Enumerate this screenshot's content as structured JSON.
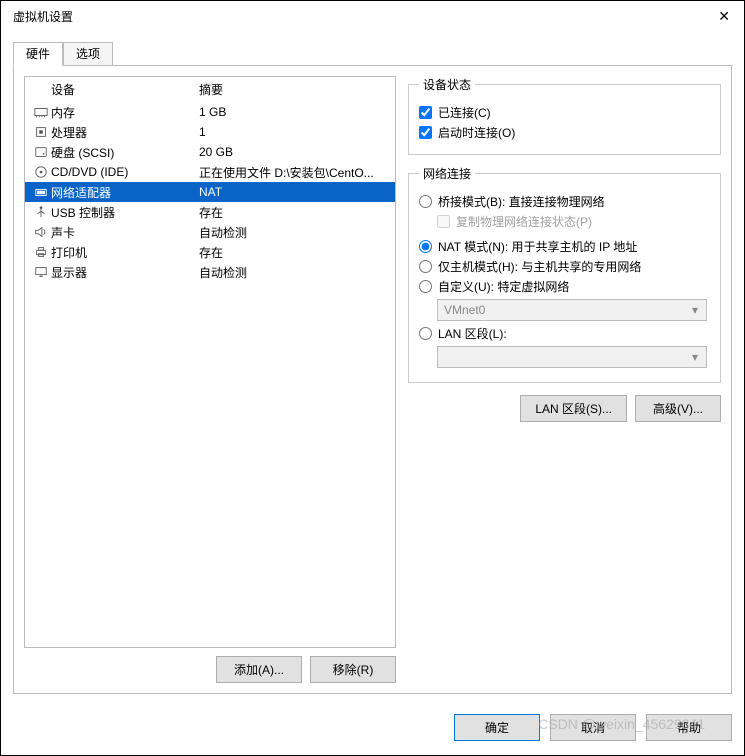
{
  "window": {
    "title": "虚拟机设置"
  },
  "tabs": {
    "hardware": "硬件",
    "options": "选项",
    "active": "hardware"
  },
  "headers": {
    "device": "设备",
    "summary": "摘要"
  },
  "devices": [
    {
      "name": "内存",
      "summary": "1 GB",
      "icon": "memory"
    },
    {
      "name": "处理器",
      "summary": "1",
      "icon": "cpu"
    },
    {
      "name": "硬盘 (SCSI)",
      "summary": "20 GB",
      "icon": "disk"
    },
    {
      "name": "CD/DVD (IDE)",
      "summary": "正在使用文件 D:\\安装包\\CentO...",
      "icon": "optical"
    },
    {
      "name": "网络适配器",
      "summary": "NAT",
      "icon": "network",
      "selected": true
    },
    {
      "name": "USB 控制器",
      "summary": "存在",
      "icon": "usb"
    },
    {
      "name": "声卡",
      "summary": "自动检测",
      "icon": "sound"
    },
    {
      "name": "打印机",
      "summary": "存在",
      "icon": "printer"
    },
    {
      "name": "显示器",
      "summary": "自动检测",
      "icon": "display"
    }
  ],
  "buttons": {
    "add": "添加(A)...",
    "remove": "移除(R)",
    "lanSegments": "LAN 区段(S)...",
    "advanced": "高级(V)...",
    "ok": "确定",
    "cancel": "取消",
    "help": "帮助"
  },
  "status": {
    "legend": "设备状态",
    "connected": "已连接(C)",
    "connectAtPower": "启动时连接(O)"
  },
  "net": {
    "legend": "网络连接",
    "bridged": "桥接模式(B): 直接连接物理网络",
    "replicate": "复制物理网络连接状态(P)",
    "nat": "NAT 模式(N): 用于共享主机的 IP 地址",
    "hostOnly": "仅主机模式(H): 与主机共享的专用网络",
    "custom": "自定义(U): 特定虚拟网络",
    "customValue": "VMnet0",
    "lan": "LAN 区段(L):",
    "lanValue": ""
  },
  "watermark": "CSDN @weixin_45629341"
}
